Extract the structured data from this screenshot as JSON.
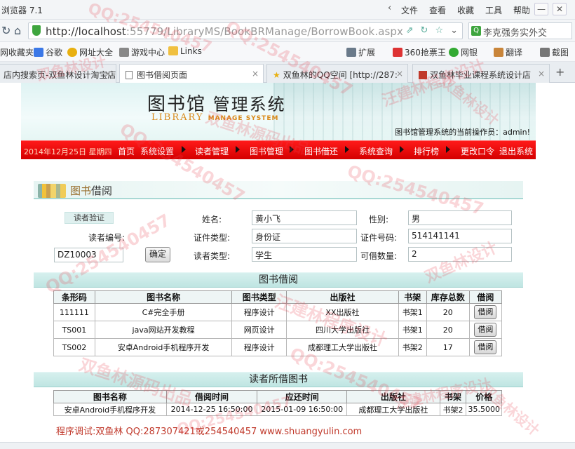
{
  "browser": {
    "title": "浏览器 7.1",
    "menu": [
      "文件",
      "查看",
      "收藏",
      "工具",
      "帮助"
    ],
    "url_host": "http://localhost",
    "url_rest": ":55779/LibraryMS/BookBRManage/BorrowBook.aspx",
    "search_text": "李克强务实外交",
    "favorites": [
      "网收藏夹",
      "谷歌",
      "网址大全",
      "游戏中心",
      "Links",
      "扩展",
      "360抢票王",
      "网银",
      "翻译",
      "截图"
    ],
    "tabs": [
      {
        "label": "店内搜索页-双鱼林设计淘宝店"
      },
      {
        "label": "图书借阅页面"
      },
      {
        "label": "双鱼林的QQ空间 [http://287:"
      },
      {
        "label": "双鱼林毕业课程系统设计店"
      }
    ],
    "new_tab": "+"
  },
  "header": {
    "logo_cn_a": "图书馆",
    "logo_cn_b": "管理系统",
    "logo_en_a": "LIBRARY ",
    "logo_en_b": "MANAGE SYSTEM",
    "operator": "图书馆管理系统的当前操作员：admin!"
  },
  "nav": {
    "date": "2014年12月25日 星期四",
    "items": [
      "首页",
      "系统设置",
      "读者管理",
      "图书管理",
      "图书借还",
      "系统查询",
      "排行榜",
      "更改口令",
      "退出系统"
    ]
  },
  "section": {
    "title_a": "图书",
    "title_b": "借阅"
  },
  "reader": {
    "verify_label": "读者验证",
    "id_label": "读者编号:",
    "id_value": "DZ10003",
    "confirm": "确定",
    "name_label": "姓名:",
    "name_value": "黄小飞",
    "gender_label": "性别:",
    "gender_value": "男",
    "cert_type_label": "证件类型:",
    "cert_type_value": "身份证",
    "cert_no_label": "证件号码:",
    "cert_no_value": "514141141",
    "reader_type_label": "读者类型:",
    "reader_type_value": "学生",
    "quota_label": "可借数量:",
    "quota_value": "2"
  },
  "borrow_table": {
    "title": "图书借阅",
    "headers": [
      "条形码",
      "图书名称",
      "图书类型",
      "出版社",
      "书架",
      "库存总数",
      "借阅"
    ],
    "rows": [
      [
        "111111",
        "C#完全手册",
        "程序设计",
        "XX出版社",
        "书架1",
        "20",
        "借阅"
      ],
      [
        "TS001",
        "java网站开发教程",
        "网页设计",
        "四川大学出版社",
        "书架1",
        "20",
        "借阅"
      ],
      [
        "TS002",
        "安卓Android手机程序开发",
        "程序设计",
        "成都理工大学出版社",
        "书架2",
        "17",
        "借阅"
      ]
    ]
  },
  "lent_table": {
    "title": "读者所借图书",
    "headers": [
      "图书名称",
      "借阅时间",
      "应还时间",
      "出版社",
      "书架",
      "价格"
    ],
    "rows": [
      [
        "安卓Android手机程序开发",
        "2014-12-25 16:50:00",
        "2015-01-09 16:50:00",
        "成都理工大学出版社",
        "书架2",
        "35.5000"
      ]
    ]
  },
  "footer": "程序调试:双鱼林 QQ:287307421或254540457 www.shuangyulin.com",
  "watermarks": [
    "QQ:254540457",
    "双鱼林设计",
    "双鱼林源码出品",
    "汪建林程序设计"
  ],
  "colors": {
    "nav_red": "#e00000",
    "teal_bar": "#bfe5e2",
    "footer_red": "#c0392b"
  }
}
